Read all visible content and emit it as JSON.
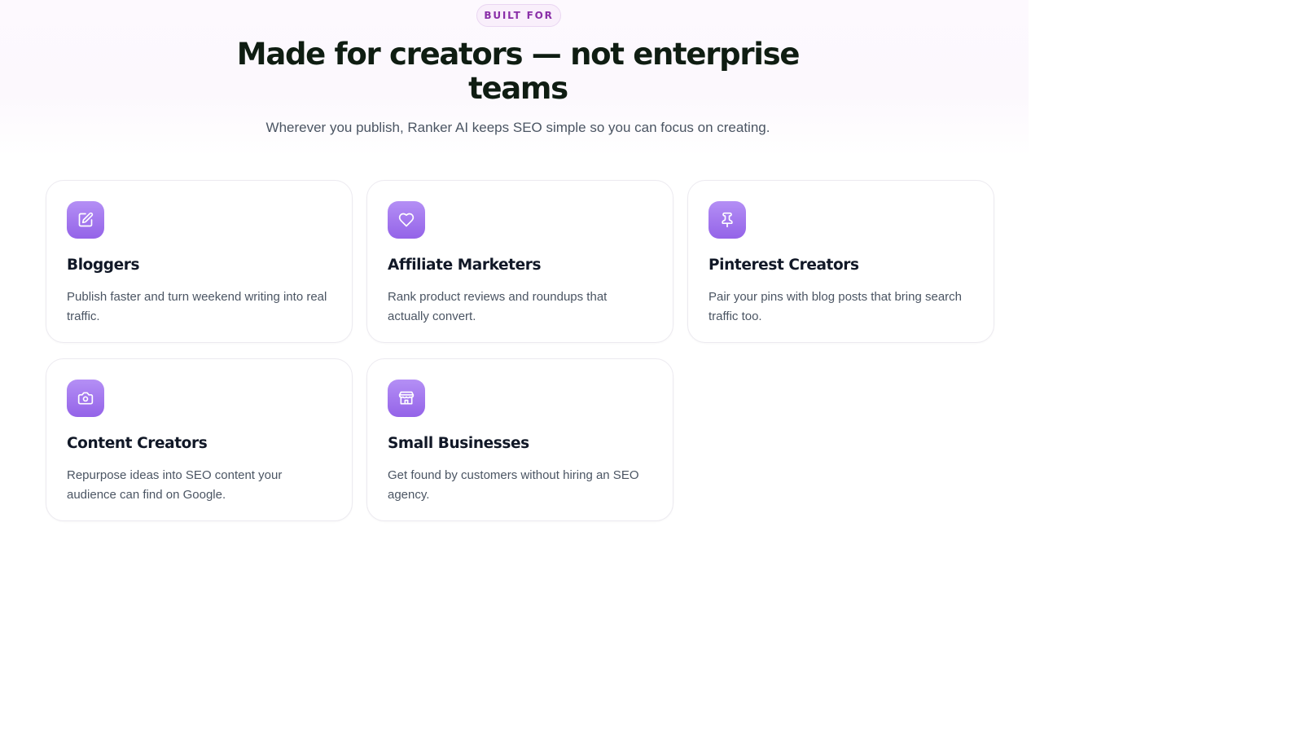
{
  "section": {
    "eyebrow": "BUILT FOR",
    "title": "Made for creators — not enterprise teams",
    "subtitle": "Wherever you publish, Ranker AI keeps SEO simple so you can focus on creating."
  },
  "cards": [
    {
      "icon": "edit-icon",
      "title": "Bloggers",
      "description": "Publish faster and turn weekend writing into real traffic."
    },
    {
      "icon": "heart-icon",
      "title": "Affiliate Marketers",
      "description": "Rank product reviews and roundups that actually convert."
    },
    {
      "icon": "pin-icon",
      "title": "Pinterest Creators",
      "description": "Pair your pins with blog posts that bring search traffic too."
    },
    {
      "icon": "camera-icon",
      "title": "Content Creators",
      "description": "Repurpose ideas into SEO content your audience can find on Google."
    },
    {
      "icon": "store-icon",
      "title": "Small Businesses",
      "description": "Get found by customers without hiring an SEO agency."
    }
  ],
  "colors": {
    "accent": "#9463e8",
    "eyebrow_text": "#8a2fa8",
    "heading": "#0f1d12",
    "body_text": "#4b5563"
  }
}
